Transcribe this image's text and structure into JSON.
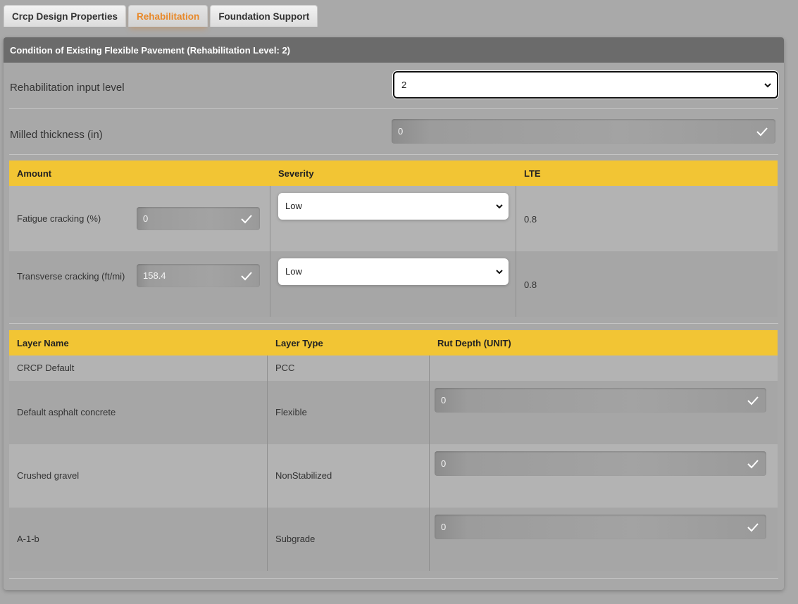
{
  "tabs": [
    {
      "label": "Crcp Design Properties"
    },
    {
      "label": "Rehabilitation"
    },
    {
      "label": "Foundation Support"
    }
  ],
  "panel": {
    "title": "Condition of Existing Flexible Pavement (Rehabilitation Level: 2)",
    "rehab_level": {
      "label": "Rehabilitation input level",
      "value": "2"
    },
    "milled_thickness": {
      "label": "Milled thickness (in)",
      "value": "0"
    }
  },
  "distress_table": {
    "headers": [
      "Amount",
      "Severity",
      "LTE"
    ],
    "rows": [
      {
        "label": "Fatigue cracking (%)",
        "amount": "0",
        "severity": "Low",
        "lte": "0.8"
      },
      {
        "label": "Transverse cracking (ft/mi)",
        "amount": "158.4",
        "severity": "Low",
        "lte": "0.8"
      }
    ]
  },
  "layer_table": {
    "headers": [
      "Layer Name",
      "Layer Type",
      "Rut Depth (UNIT)"
    ],
    "rows": [
      {
        "name": "CRCP Default",
        "type": "PCC",
        "rut": null
      },
      {
        "name": "Default asphalt concrete",
        "type": "Flexible",
        "rut": "0"
      },
      {
        "name": "Crushed gravel",
        "type": "NonStabilized",
        "rut": "0"
      },
      {
        "name": "A-1-b",
        "type": "Subgrade",
        "rut": "0"
      }
    ]
  },
  "colors": {
    "header_yellow": "#f2c534",
    "active_tab": "#e8892a",
    "panel_header": "#6b6b6b"
  }
}
